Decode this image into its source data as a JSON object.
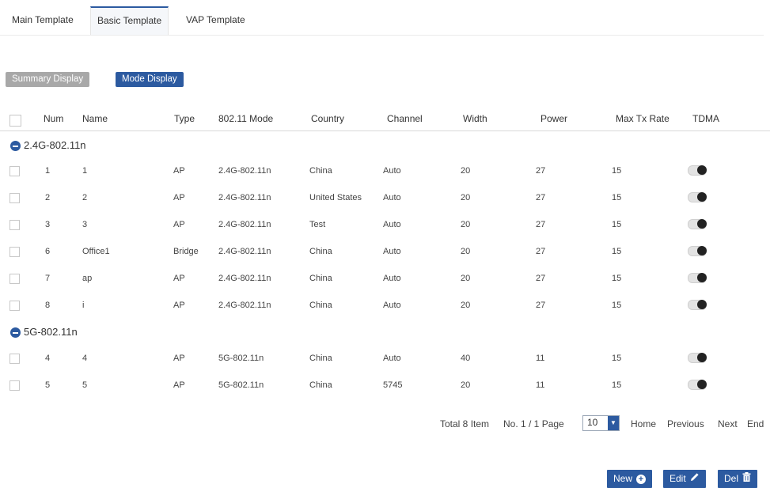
{
  "tabs": [
    {
      "label": "Main Template"
    },
    {
      "label": "Basic Template"
    },
    {
      "label": "VAP Template"
    }
  ],
  "active_tab": "Basic Template",
  "mode_buttons": {
    "summary": "Summary Display",
    "mode": "Mode Display"
  },
  "columns": {
    "num": "Num",
    "name": "Name",
    "type": "Type",
    "mode": "802.11 Mode",
    "country": "Country",
    "channel": "Channel",
    "width": "Width",
    "power": "Power",
    "max_tx_rate": "Max Tx Rate",
    "tdma": "TDMA"
  },
  "groups": [
    {
      "label": "2.4G-802.11n",
      "rows": [
        {
          "num": "1",
          "name": "1",
          "type": "AP",
          "mode": "2.4G-802.11n",
          "country": "China",
          "channel": "Auto",
          "width": "20",
          "power": "27",
          "max_tx_rate": "15",
          "tdma": "off"
        },
        {
          "num": "2",
          "name": "2",
          "type": "AP",
          "mode": "2.4G-802.11n",
          "country": "United States",
          "channel": "Auto",
          "width": "20",
          "power": "27",
          "max_tx_rate": "15",
          "tdma": "off"
        },
        {
          "num": "3",
          "name": "3",
          "type": "AP",
          "mode": "2.4G-802.11n",
          "country": "Test",
          "channel": "Auto",
          "width": "20",
          "power": "27",
          "max_tx_rate": "15",
          "tdma": "off"
        },
        {
          "num": "6",
          "name": "Office1",
          "type": "Bridge",
          "mode": "2.4G-802.11n",
          "country": "China",
          "channel": "Auto",
          "width": "20",
          "power": "27",
          "max_tx_rate": "15",
          "tdma": "off"
        },
        {
          "num": "7",
          "name": "ap",
          "type": "AP",
          "mode": "2.4G-802.11n",
          "country": "China",
          "channel": "Auto",
          "width": "20",
          "power": "27",
          "max_tx_rate": "15",
          "tdma": "off"
        },
        {
          "num": "8",
          "name": "i",
          "type": "AP",
          "mode": "2.4G-802.11n",
          "country": "China",
          "channel": "Auto",
          "width": "20",
          "power": "27",
          "max_tx_rate": "15",
          "tdma": "off"
        }
      ]
    },
    {
      "label": "5G-802.11n",
      "rows": [
        {
          "num": "4",
          "name": "4",
          "type": "AP",
          "mode": "5G-802.11n",
          "country": "China",
          "channel": "Auto",
          "width": "40",
          "power": "11",
          "max_tx_rate": "15",
          "tdma": "off"
        },
        {
          "num": "5",
          "name": "5",
          "type": "AP",
          "mode": "5G-802.11n",
          "country": "China",
          "channel": "5745",
          "width": "20",
          "power": "11",
          "max_tx_rate": "15",
          "tdma": "off"
        }
      ]
    }
  ],
  "pagination": {
    "total": "Total 8 Item",
    "page_info": "No. 1 / 1 Page",
    "page_size": "10",
    "home": "Home",
    "previous": "Previous",
    "next": "Next",
    "end": "End"
  },
  "actions": {
    "new": "New",
    "edit": "Edit",
    "del": "Del"
  },
  "colors": {
    "accent": "#2c5aa0",
    "disabled_button": "#a8a8a8"
  },
  "icons": {
    "new": "plus-circle-icon",
    "edit": "pencil-icon",
    "del": "trash-icon",
    "group": "minus-circle-icon"
  }
}
